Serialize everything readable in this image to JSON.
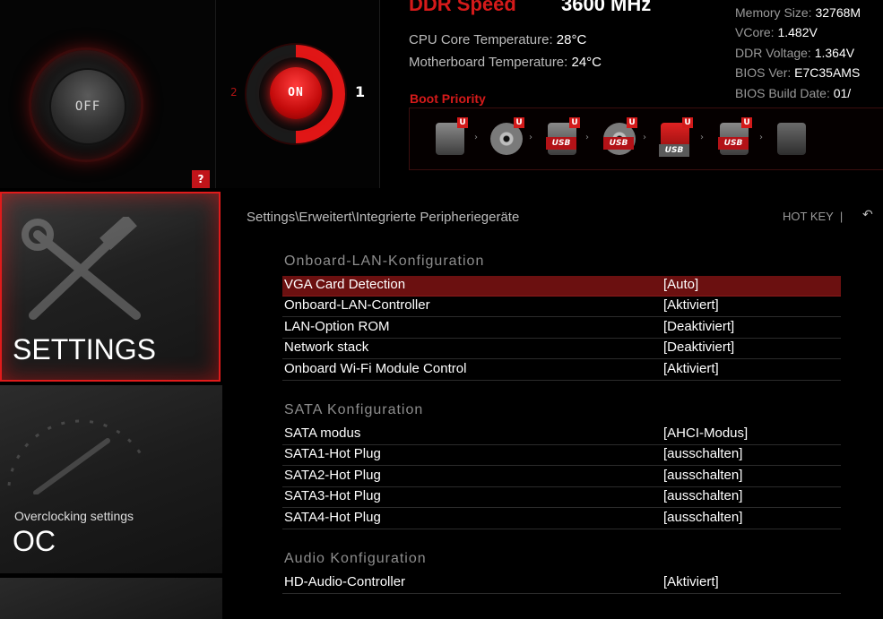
{
  "boost": {
    "off_label": "OFF",
    "on_label": "ON",
    "profile_left": "2",
    "profile_right": "1",
    "help_label": "?"
  },
  "info": {
    "ddr_label": "DDR Speed",
    "ddr_value": "3600 MHz",
    "cpu_temp_label": "CPU Core Temperature:",
    "cpu_temp_value": "28°C",
    "mb_temp_label": "Motherboard Temperature:",
    "mb_temp_value": "24°C",
    "memory_size_label": "Memory Size:",
    "memory_size_value": "32768M",
    "vcore_label": "VCore:",
    "vcore_value": "1.482V",
    "ddr_voltage_label": "DDR Voltage:",
    "ddr_voltage_value": "1.364V",
    "bios_ver_label": "BIOS Ver:",
    "bios_ver_value": "E7C35AMS",
    "bios_date_label": "BIOS Build Date:",
    "bios_date_value": "01/",
    "boot_priority_title": "Boot Priority",
    "boot_devices": [
      {
        "icon": "hard-drive-icon",
        "badge": "U"
      },
      {
        "icon": "optical-disc-icon",
        "badge": "U"
      },
      {
        "icon": "usb-drive-icon",
        "badge": "U",
        "tag": "USB"
      },
      {
        "icon": "usb-optical-icon",
        "badge": "U",
        "tag": "USB"
      },
      {
        "icon": "usb-key-icon",
        "badge": "U",
        "tag": "USB"
      },
      {
        "icon": "usb-floppy-icon",
        "badge": "U",
        "tag": "USB"
      },
      {
        "icon": "network-icon",
        "badge": ""
      }
    ]
  },
  "nav": {
    "settings_title": "SETTINGS",
    "oc_subtitle": "Overclocking settings",
    "oc_title": "OC"
  },
  "header": {
    "breadcrumb": "Settings\\Erweitert\\Integrierte Peripheriegeräte",
    "hotkey_label": "HOT KEY",
    "hotkey_sep": "|",
    "back_icon": "↶"
  },
  "sections": [
    {
      "title": "Onboard-LAN-Konfiguration",
      "rows": [
        {
          "label": "VGA Card Detection",
          "value": "[Auto]"
        },
        {
          "label": "Onboard-LAN-Controller",
          "value": "[Aktiviert]"
        },
        {
          "label": "LAN-Option ROM",
          "value": "[Deaktiviert]"
        },
        {
          "label": "Network stack",
          "value": "[Deaktiviert]"
        },
        {
          "label": "Onboard Wi-Fi Module Control",
          "value": "[Aktiviert]"
        }
      ]
    },
    {
      "title": "SATA  Konfiguration",
      "rows": [
        {
          "label": "SATA modus",
          "value": "[AHCI-Modus]"
        },
        {
          "label": "SATA1-Hot Plug",
          "value": "[ausschalten]"
        },
        {
          "label": "SATA2-Hot Plug",
          "value": "[ausschalten]"
        },
        {
          "label": "SATA3-Hot Plug",
          "value": "[ausschalten]"
        },
        {
          "label": "SATA4-Hot Plug",
          "value": "[ausschalten]"
        }
      ]
    },
    {
      "title": "Audio  Konfiguration",
      "rows": [
        {
          "label": "HD-Audio-Controller",
          "value": "[Aktiviert]"
        }
      ]
    }
  ],
  "colors": {
    "accent": "#e01b1b",
    "selected_row": "#6b1010"
  }
}
